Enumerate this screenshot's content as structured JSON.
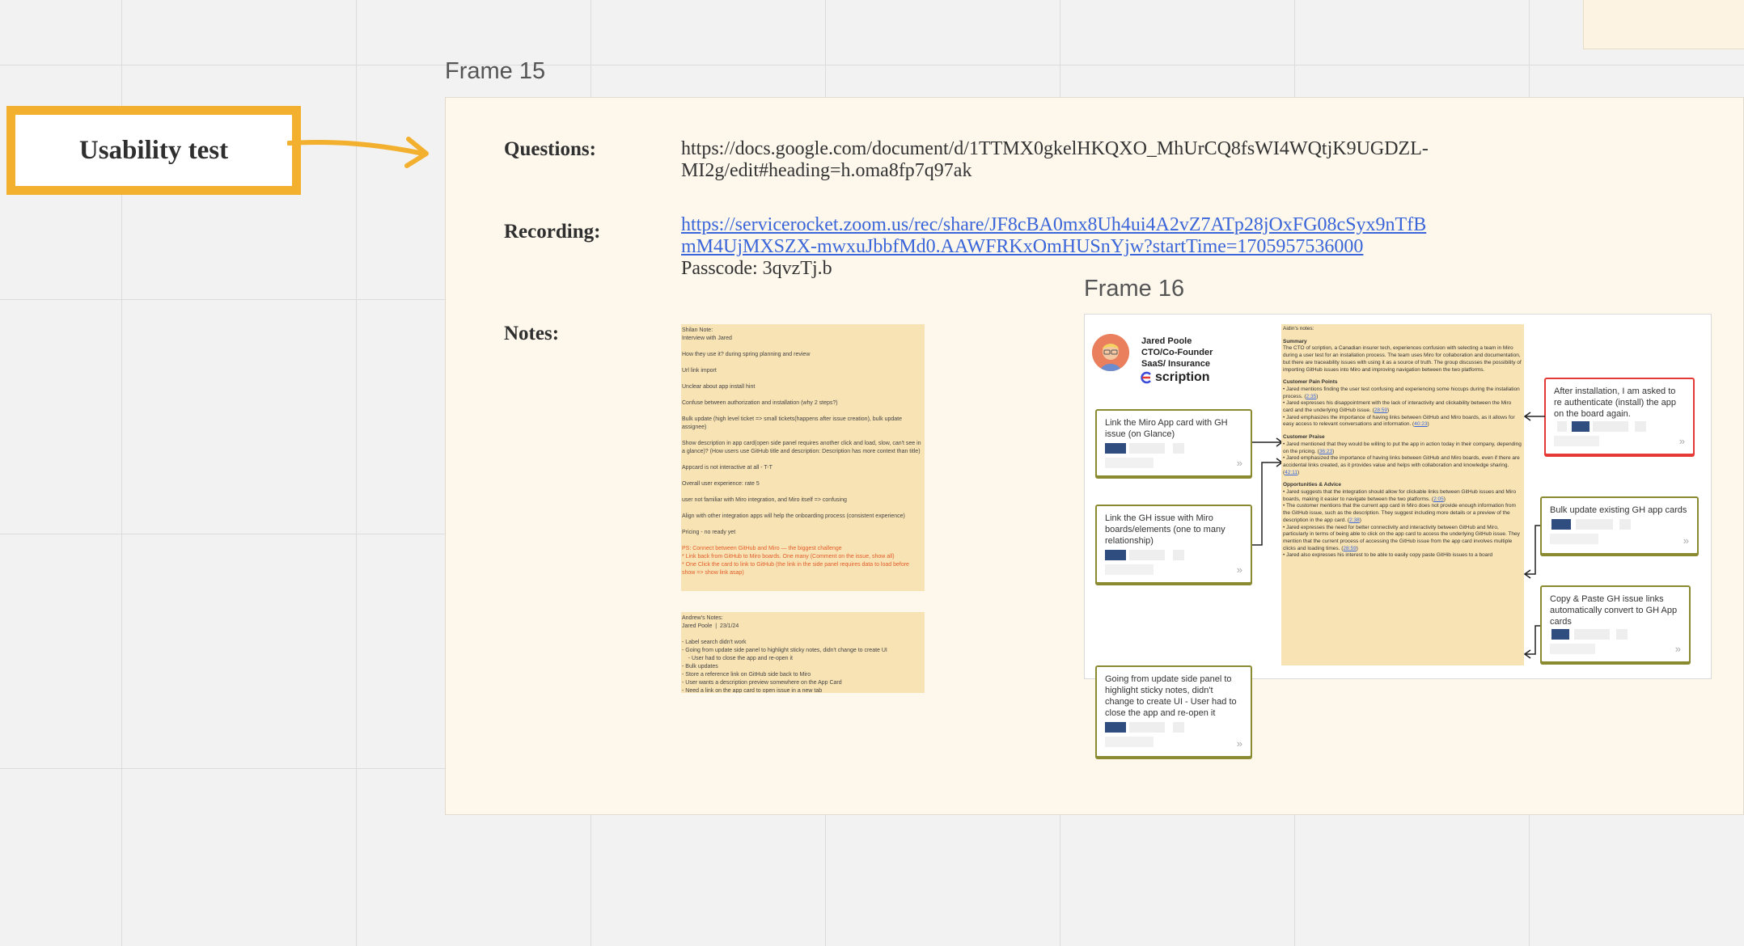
{
  "usability_label": "Usability test",
  "frame15": {
    "title": "Frame 15",
    "questions_label": "Questions:",
    "questions_url_line1": "https://docs.google.com/document/d/1TTMX0gkelHKQXO_MhUrCQ8fsWI4WQtjK9UGDZL-",
    "questions_url_line2": "MI2g/edit#heading=h.oma8fp7q97ak",
    "recording_label": "Recording:",
    "recording_url_line1": "https://servicerocket.zoom.us/rec/share/JF8cBA0mx8Uh4ui4A2vZ7ATp28jOxFG08cSyx9nTfB",
    "recording_url_line2": "mM4UjMXSZX-mwxuJbbfMd0.AAWFRKxOmHUSnYjw?startTime=1705957536000",
    "passcode": "Passcode: 3qvzTj.b",
    "notes_label": "Notes:"
  },
  "shilan_note": {
    "header": "Shilan Note:\nInterview with Jared",
    "items": [
      "How they use it? during spring planning and review",
      "Url link import",
      "Unclear about app install hint",
      "Confuse between authorization and installation (why 2 steps?)",
      "Bulk update (high level ticket => small tickets(happens after issue creation), bulk update assignee)",
      "Show description in app card(open side panel requires another click and load, slow, can't see in a glance)? (How users use GitHub title and description: Description has more context than title)",
      "Appcard is not interactive at all - T-T",
      "",
      "Overall user experience: rate 5",
      "user not familiar with Miro integration, and Miro itself => confusing",
      "Align with other integration apps will help the onboarding process (consistent experience)",
      "Pricing - no ready yet"
    ],
    "orange_lines": "PS: Connect between GitHub and Miro — the biggest challenge\n* Link back from GitHub to Miro boards. One many (Comment on the issue, show all)\n* One Click the card to link to GitHub (the link in the side panel requires data to load before show => show link asap)"
  },
  "andrew_note": {
    "text": "Andrew's Notes:\nJared Poole  |  23/1/24\n\n- Label search didn't work\n- Going from update side panel to highlight sticky notes, didn't change to create UI\n    - User had to close the app and re-open it\n- Bulk updates\n- Store a reference link on GitHub side back to Miro\n- User wants a description preview somewhere on the App Card\n- Need a link on the app card to open issue in a new tab"
  },
  "frame16": {
    "title": "Frame 16",
    "person_name": "Jared Poole",
    "person_role": "CTO/Co-Founder",
    "person_industry": "SaaS/ Insurance",
    "logo_text": "scription",
    "cards": {
      "link_app_card": "Link the Miro App card with GH issue (on Glance)",
      "link_gh_issue": "Link the GH issue with Miro boards/elements (one to many relationship)",
      "side_panel": "Going from update side panel to highlight sticky notes, didn't change to create UI  - User had to close the app and re-open it",
      "reauth": "After installation, I am asked to re authenticate (install) the app on the board again.",
      "bulk_update": "Bulk update existing GH app cards",
      "copy_paste": "Copy & Paste GH issue links automatically convert to GH App cards"
    },
    "aidin_notes": {
      "header": "Aidin's notes:",
      "summary_title": "Summary",
      "summary": "The CTO of scription, a Canadian insurer tech, experiences confusion with selecting a team in Miro during a user test for an installation process. The team uses Miro for collaboration and documentation, but there are traceability issues with using it as a source of truth. The group discusses the possibility of importing GitHub issues into Miro and improving navigation between the two platforms.",
      "pain_title": "Customer Pain Points",
      "pain_1": "• Jared mentions finding the user test confusing and experiencing some hiccups during the installation process. (",
      "pain_1_ts": "2:35",
      "pain_2": "• Jared expresses his disappointment with the lack of interactivity and clickability between the Miro card and the underlying GitHub issue. (",
      "pain_2_ts": "28:59",
      "pain_3": "• Jared emphasizes the importance of having links between GitHub and Miro boards, as it allows for easy access to relevant conversations and information. (",
      "pain_3_ts": "40:23",
      "praise_title": "Customer Praise",
      "praise_1": "• Jared mentioned that they would be willing to put the app in action today in their company, depending on the pricing. (",
      "praise_1_ts": "36:23",
      "praise_2": "• Jared emphasized the importance of having links between GitHub and Miro boards, even if there are accidental links created, as it provides value and helps with collaboration and knowledge sharing. (",
      "praise_2_ts": "42:11",
      "opp_title": "Opportunities & Advice",
      "opp_1": "• Jared suggests that the integration should allow for clickable links between GitHub issues and Miro boards, making it easier to navigate between the two platforms. (",
      "opp_1_ts": "2:05",
      "opp_2": "• The customer mentions that the current app card in Miro does not provide enough information from the GitHub issue, such as the description. They suggest including more details or a preview of the description in the app card. (",
      "opp_2_ts": "2:38",
      "opp_3": "• Jared expresses the need for better connectivity and interactivity between GitHub and Miro, particularly in terms of being able to click on the app card to access the underlying GitHub issue. They mention that the current process of accessing the GitHub issue from the app card involves multiple clicks and loading times. (",
      "opp_3_ts": "28:59",
      "opp_4": "• Jared also expresses his interest to be able to easily copy paste GitHib issues to a board"
    }
  },
  "colors": {
    "accent_orange": "#f3b02f",
    "sticky_yellow": "#f8e3b4",
    "frame_bg": "#fdf7ec",
    "card_border": "#8a8a30",
    "card_alert": "#e53935",
    "link_blue": "#3a66d9"
  }
}
